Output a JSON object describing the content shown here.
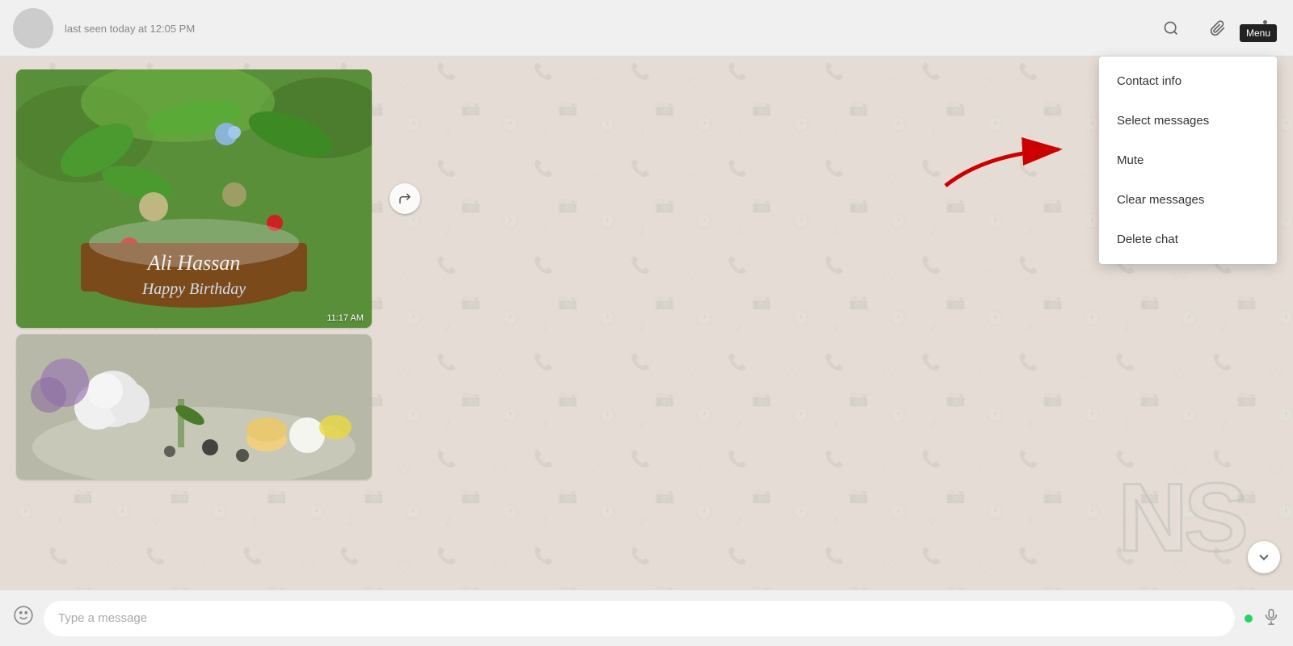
{
  "header": {
    "status": "last seen today at 12:05 PM",
    "menu_tooltip": "Menu"
  },
  "toolbar": {
    "search_label": "Search",
    "attach_label": "Attach",
    "menu_label": "More options"
  },
  "dropdown": {
    "items": [
      {
        "id": "contact-info",
        "label": "Contact info"
      },
      {
        "id": "select-messages",
        "label": "Select messages"
      },
      {
        "id": "mute",
        "label": "Mute"
      },
      {
        "id": "clear-messages",
        "label": "Clear messages"
      },
      {
        "id": "delete-chat",
        "label": "Delete chat"
      }
    ]
  },
  "messages": [
    {
      "id": "msg-cake",
      "time": "11:17 AM",
      "caption": "Ali Hassan Happy Birthday"
    }
  ],
  "input": {
    "placeholder": "Type a message"
  },
  "watermark": "NS"
}
